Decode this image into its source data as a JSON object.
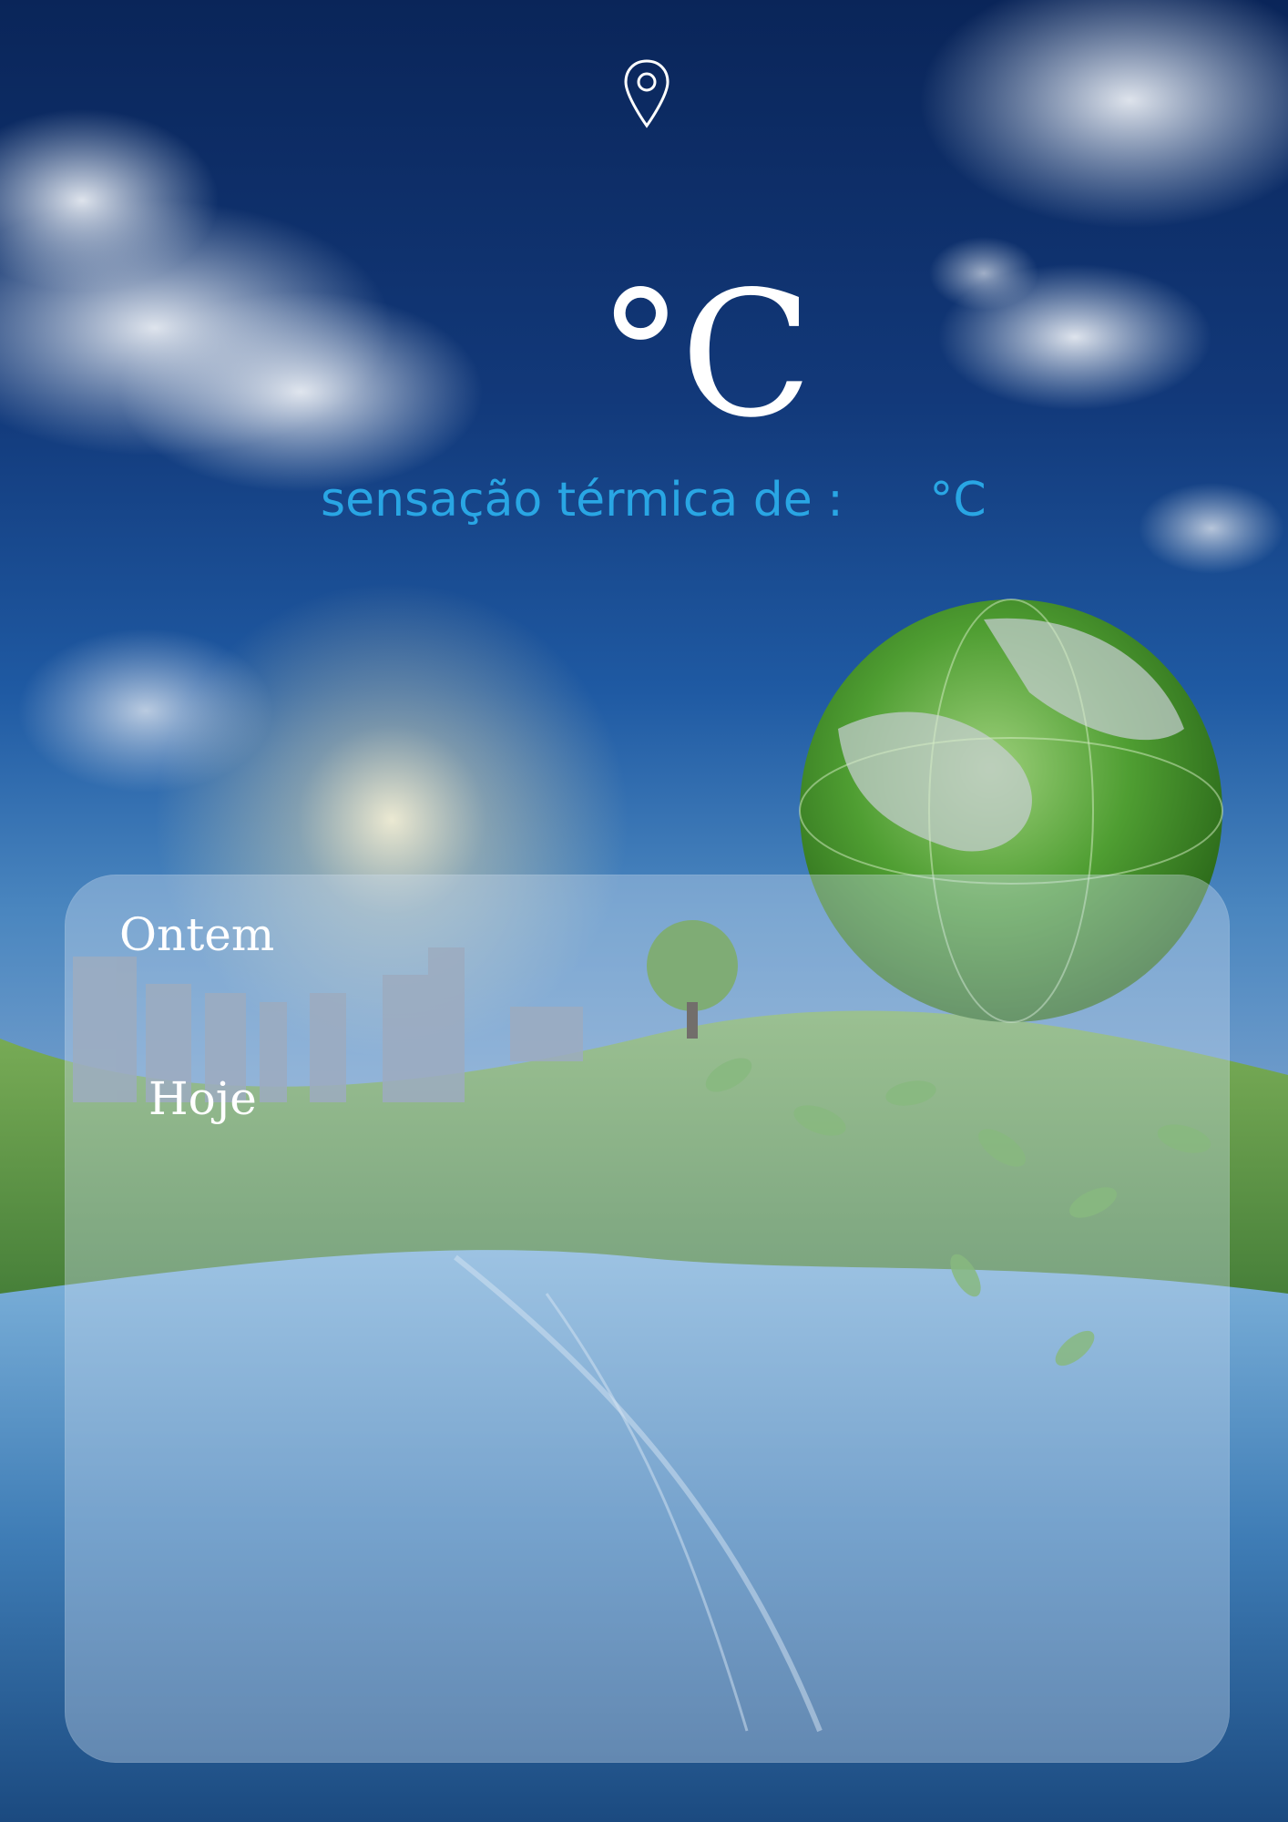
{
  "header": {
    "location_icon": "location-pin-icon"
  },
  "current": {
    "temperature": "",
    "unit": "°C",
    "feels_like_label": "sensação térmica de :",
    "feels_like_value": "",
    "feels_like_unit": "°C"
  },
  "history": {
    "yesterday_label": "Ontem",
    "today_label": "Hoje"
  },
  "colors": {
    "feels_like_text": "#29a6e4",
    "primary_text": "#ffffff"
  }
}
